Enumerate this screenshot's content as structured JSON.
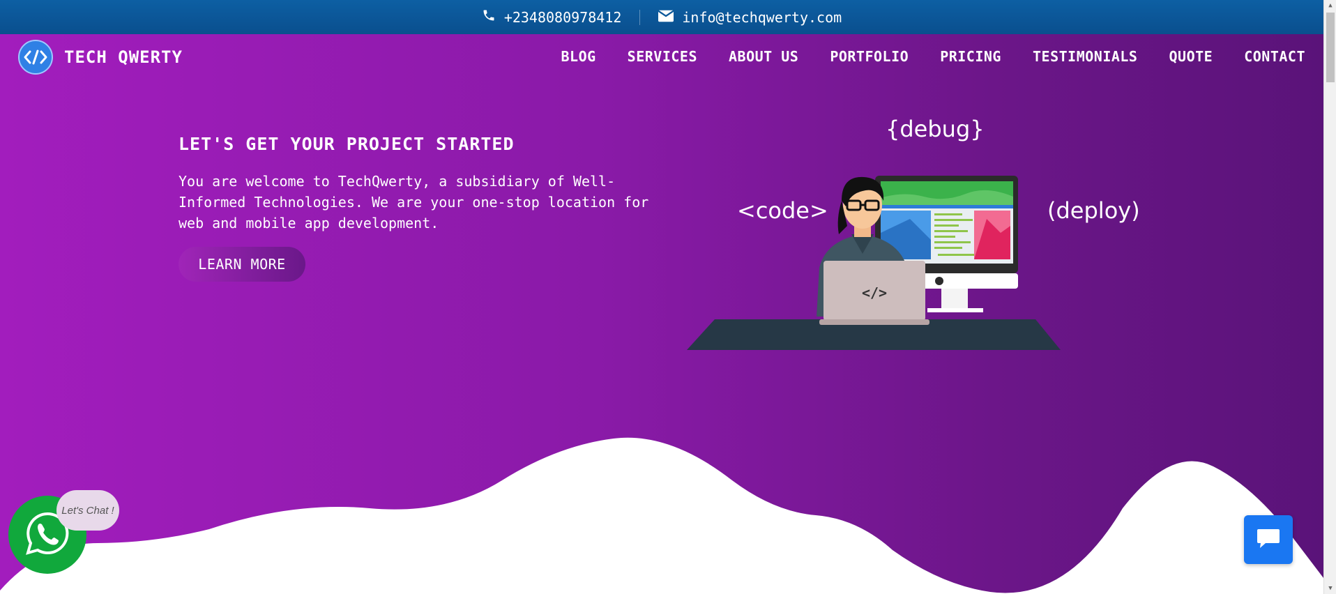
{
  "topbar": {
    "phone": "+2348080978412",
    "email": "info@techqwerty.com",
    "phone_icon": "phone-icon",
    "email_icon": "envelope-icon"
  },
  "brand": {
    "name": "TECH QWERTY",
    "logo_icon": "code-brackets-icon"
  },
  "nav": {
    "items": [
      {
        "label": "BLOG"
      },
      {
        "label": "SERVICES"
      },
      {
        "label": "ABOUT US"
      },
      {
        "label": "PORTFOLIO"
      },
      {
        "label": "PRICING"
      },
      {
        "label": "TESTIMONIALS"
      },
      {
        "label": "QUOTE"
      },
      {
        "label": "CONTACT"
      }
    ]
  },
  "hero": {
    "heading": "LET'S GET YOUR PROJECT STARTED",
    "description": "You are welcome to TechQwerty, a subsidiary of Well-Informed Technologies. We are your one-stop location for web and mobile app development.",
    "cta_label": "LEARN MORE",
    "tags": {
      "debug": "{debug}",
      "code": "<code>",
      "deploy": "(deploy)"
    },
    "laptop_label": "</>"
  },
  "widgets": {
    "whatsapp_bubble": "Let's Chat !",
    "whatsapp_icon": "whatsapp-icon",
    "chat_icon": "chat-bubble-icon"
  },
  "colors": {
    "topbar": "#0a4f8e",
    "hero_start": "#a21dbd",
    "hero_end": "#5a1379",
    "whatsapp": "#11a83c",
    "chat_button": "#1a77f2"
  }
}
